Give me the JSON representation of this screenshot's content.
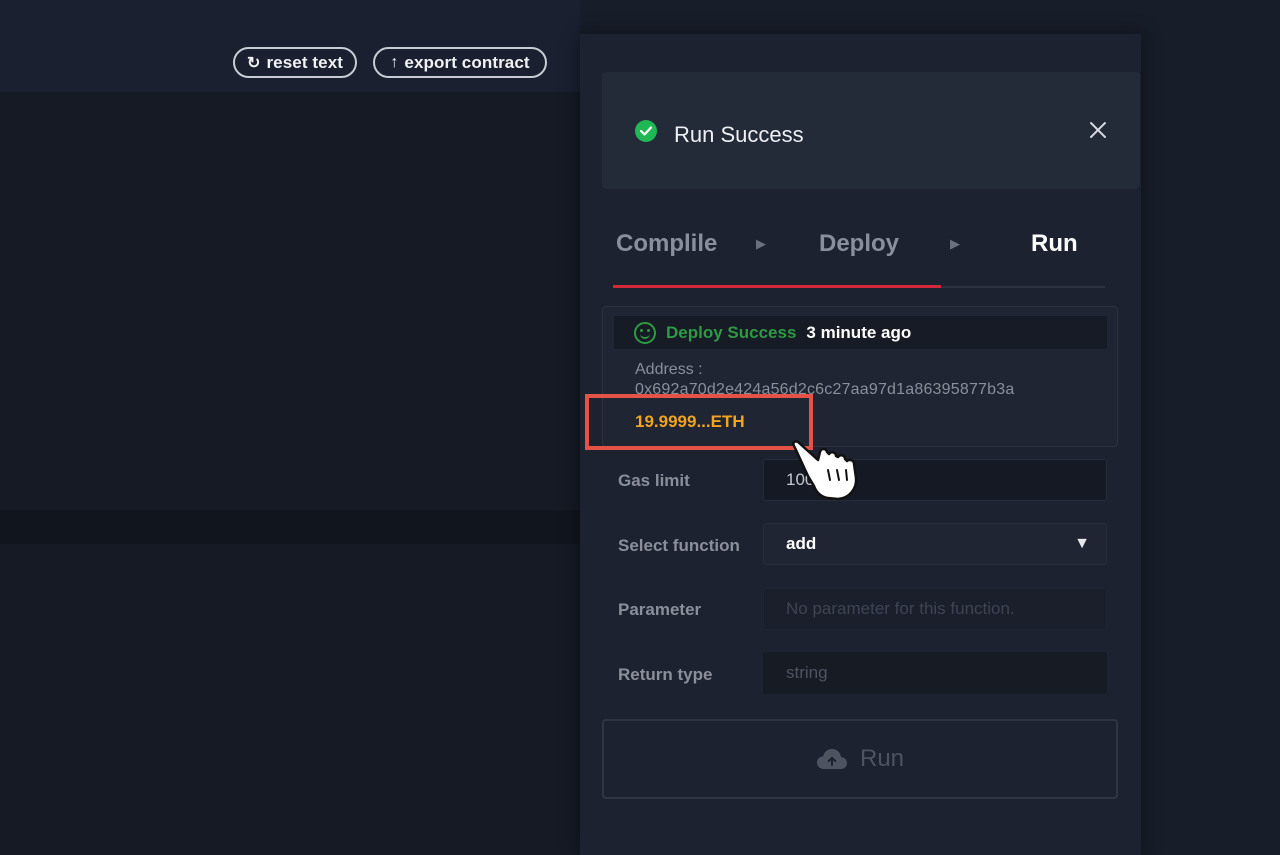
{
  "toolbar": {
    "reset_label": "reset text",
    "export_label": "export contract",
    "reset_icon": "refresh-icon",
    "export_icon": "upload-arrow-icon"
  },
  "toast": {
    "title": "Run Success",
    "status_color": "#1fb855"
  },
  "stepper": {
    "steps": [
      {
        "label": "Complile"
      },
      {
        "label": "Deploy"
      },
      {
        "label": "Run"
      }
    ],
    "active": "Run",
    "accent_color": "#d2293a"
  },
  "deploy": {
    "status": "Deploy Success",
    "time": "3 minute ago",
    "address_label": "Address :",
    "address": "0x692a70d2e424a56d2c6c27aa97d1a86395877b3a",
    "balance": "19.9999...ETH",
    "success_color": "#2e9a43",
    "balance_color": "#f2a41f"
  },
  "form": {
    "gas_limit": {
      "label": "Gas limit",
      "value": "100"
    },
    "select_function": {
      "label": "Select function",
      "value": "add"
    },
    "parameter": {
      "label": "Parameter",
      "placeholder": "No parameter for this function."
    },
    "return_type": {
      "label": "Return type",
      "value": "string"
    }
  },
  "run_button": {
    "label": "Run",
    "icon": "cloud-upload-icon"
  },
  "highlight_color": "#e55347"
}
